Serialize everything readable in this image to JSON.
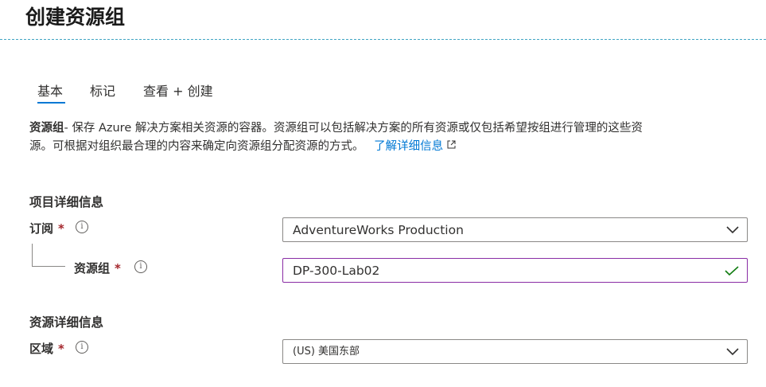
{
  "page": {
    "title": "创建资源组"
  },
  "tabs": [
    {
      "label": "基本",
      "active": true
    },
    {
      "label": "标记",
      "active": false
    },
    {
      "label": "查看 + 创建",
      "active": false
    }
  ],
  "description": {
    "term": "资源组",
    "text_line1": "- 保存 Azure 解决方案相关资源的容器。资源组可以包括解决方案的所有资源或仅包括希望按组进行管理的这些资",
    "text_line2": "源。可根据对组织最合理的内容来确定向资源组分配资源的方式。",
    "link_label": "了解详细信息"
  },
  "project_details": {
    "heading": "项目详细信息",
    "subscription": {
      "label": "订阅",
      "required_mark": "*",
      "value": "AdventureWorks Production"
    },
    "resource_group": {
      "label": "资源组",
      "required_mark": "*",
      "value": "DP-300-Lab02",
      "valid": true
    }
  },
  "resource_details": {
    "heading": "资源详细信息",
    "region": {
      "label": "区域",
      "required_mark": "*",
      "value": "(US) 美国东部"
    }
  },
  "colors": {
    "accent": "#0078d4",
    "focus_border": "#8a2da5",
    "valid_check": "#107c10",
    "required": "#a4262c",
    "separator": "#41a5c4"
  },
  "icons": {
    "info": "info-icon",
    "dropdown": "chevron-down-icon",
    "valid": "checkmark-icon",
    "external": "external-link-icon"
  }
}
